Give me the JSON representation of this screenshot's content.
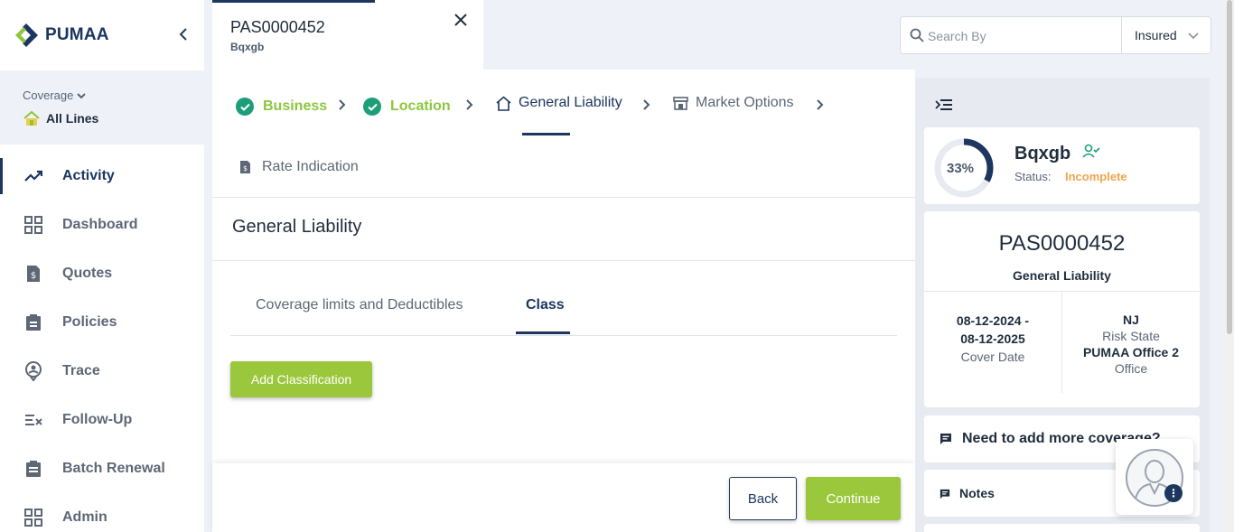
{
  "app": {
    "name": "PUMAA"
  },
  "sidebar": {
    "coverage_label": "Coverage",
    "coverage_value": "All Lines",
    "items": [
      {
        "label": "Activity",
        "icon": "trending-up-icon",
        "active": true
      },
      {
        "label": "Dashboard",
        "icon": "grid-icon"
      },
      {
        "label": "Quotes",
        "icon": "dollar-doc-icon"
      },
      {
        "label": "Policies",
        "icon": "clipboard-icon"
      },
      {
        "label": "Trace",
        "icon": "location-user-icon"
      },
      {
        "label": "Follow-Up",
        "icon": "list-check-icon"
      },
      {
        "label": "Batch Renewal",
        "icon": "clipboard-list-icon"
      },
      {
        "label": "Admin",
        "icon": "grid-icon"
      }
    ]
  },
  "tab": {
    "title": "PAS0000452",
    "subtitle": "Bqxgb"
  },
  "search": {
    "placeholder": "Search By",
    "selected": "Insured"
  },
  "steps": {
    "business": "Business",
    "location": "Location",
    "general_liability": "General Liability",
    "market_options": "Market Options",
    "rate_indication": "Rate Indication"
  },
  "section": {
    "title": "General Liability",
    "tab_coverage": "Coverage limits and Deductibles",
    "tab_class": "Class",
    "add_button": "Add Classification"
  },
  "footer": {
    "back": "Back",
    "continue": "Continue"
  },
  "summary": {
    "progress": "33%",
    "progress_value": 33,
    "insured": "Bqxgb",
    "status_label": "Status:",
    "status_value": "Incomplete",
    "policy_no": "PAS0000452",
    "policy_type": "General Liability",
    "date_start": "08-12-2024 -",
    "date_end": "08-12-2025",
    "cover_date_label": "Cover Date",
    "risk_state": "NJ",
    "risk_state_label": "Risk State",
    "office": "PUMAA Office 2",
    "office_label": "Office",
    "more_coverage": "Need to add more coverage?",
    "notes": "Notes"
  },
  "colors": {
    "navy": "#1c3660",
    "green": "#9bc73c",
    "teal": "#1e9d7a",
    "orange": "#f2a44b"
  }
}
